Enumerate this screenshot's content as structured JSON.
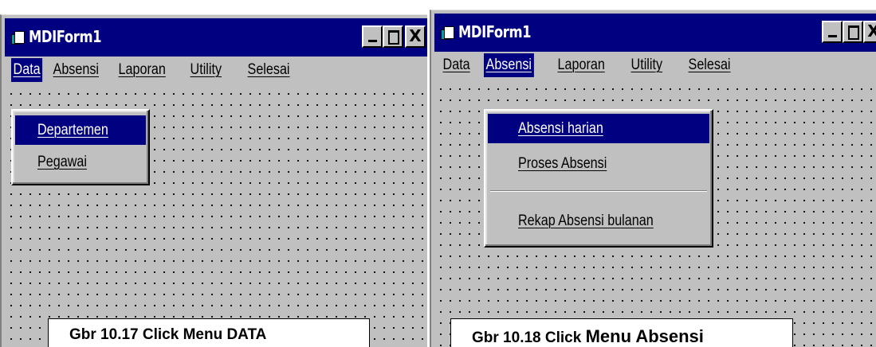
{
  "window1": {
    "title": "MDIForm1",
    "controls": {
      "minimize": "minimize",
      "maximize": "maximize",
      "close": "X"
    },
    "menu": [
      "Data",
      "Absensi",
      "Laporan",
      "Utility",
      "Selesai"
    ],
    "active_menu": "Data",
    "dropdown": [
      "Departemen",
      "Pegawai"
    ],
    "selected_item": "Departemen",
    "caption": "Gbr 10.17 Click Menu DATA"
  },
  "window2": {
    "title": "MDIForm1",
    "controls": {
      "minimize": "minimize",
      "maximize": "maximize",
      "close": "X"
    },
    "menu": [
      "Data",
      "Absensi",
      "Laporan",
      "Utility",
      "Selesai"
    ],
    "active_menu": "Absensi",
    "dropdown": [
      "Absensi harian",
      "Proses Absensi",
      "Rekap Absensi bulanan"
    ],
    "selected_item": "Absensi harian",
    "caption_prefix": "Gbr 10.18 Click ",
    "caption_suffix": "Menu Absensi"
  },
  "colors": {
    "titlebar": "#000080",
    "face": "#c0c0c0",
    "highlight": "#000080"
  }
}
